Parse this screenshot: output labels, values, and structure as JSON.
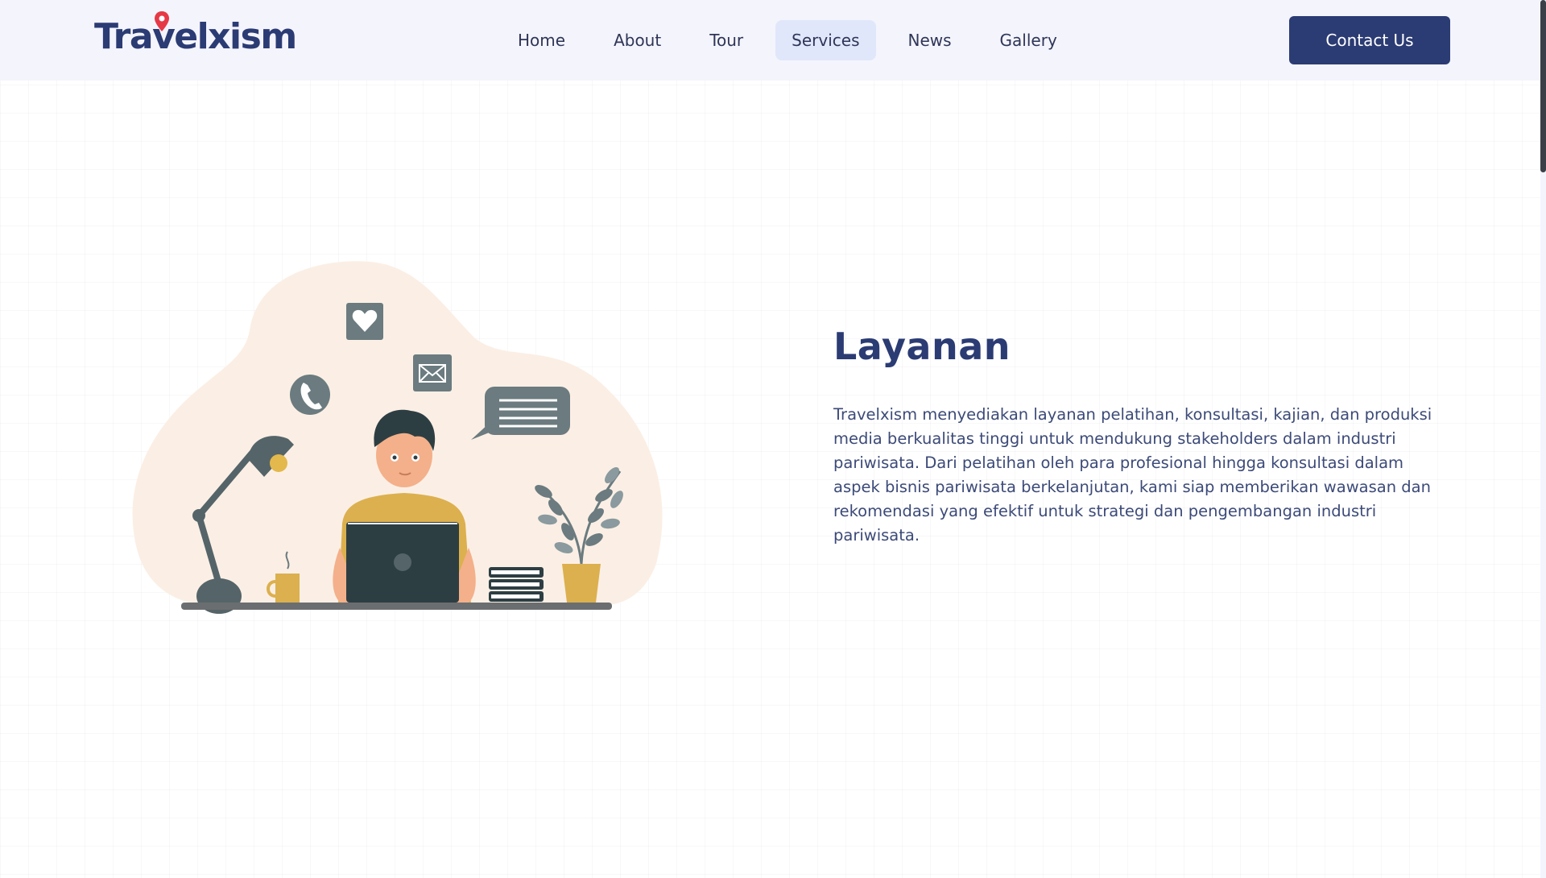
{
  "header": {
    "logo_text": "Travelxism",
    "nav": [
      {
        "label": "Home",
        "active": false
      },
      {
        "label": "About",
        "active": false
      },
      {
        "label": "Tour",
        "active": false
      },
      {
        "label": "Services",
        "active": true
      },
      {
        "label": "News",
        "active": false
      },
      {
        "label": "Gallery",
        "active": false
      }
    ],
    "contact_label": "Contact Us"
  },
  "main": {
    "title": "Layanan",
    "description": "Travelxism menyediakan layanan pelatihan, konsultasi, kajian, dan produksi media berkualitas tinggi untuk mendukung stakeholders dalam industri pariwisata. Dari pelatihan oleh para profesional hingga konsultasi dalam aspek bisnis pariwisata berkelanjutan, kami siap memberikan wawasan dan rekomendasi yang efektif untuk strategi dan pengembangan industri pariwisata."
  },
  "colors": {
    "brand": "#2b3b73",
    "pin": "#e63946",
    "header_bg": "#f4f4fd",
    "active_nav_bg": "#e0e7fa"
  },
  "illustration": {
    "icons": [
      "heart-icon",
      "mail-icon",
      "phone-icon",
      "chat-bubble-icon",
      "desk-lamp-icon",
      "laptop-icon",
      "coffee-mug-icon",
      "books-icon",
      "potted-plant-icon"
    ]
  }
}
